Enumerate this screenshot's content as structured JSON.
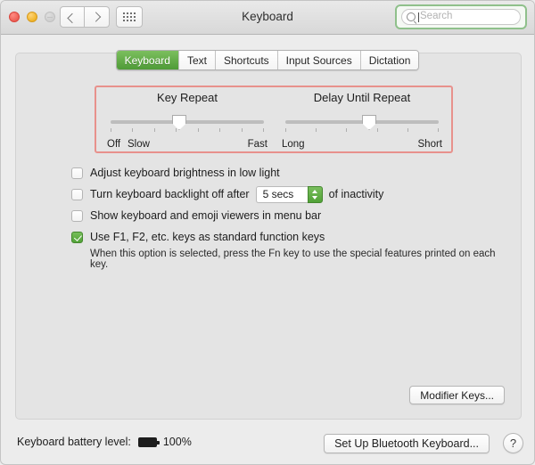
{
  "window": {
    "title": "Keyboard",
    "traffic_lights": [
      "close",
      "minimize",
      "zoom-disabled"
    ],
    "nav": {
      "back_icon": "chevron-left-icon",
      "forward_icon": "chevron-right-icon",
      "grid_icon": "show-all-grid-icon"
    }
  },
  "search": {
    "placeholder": "Search",
    "icon": "search-icon",
    "highlight_color": "#8fc08b"
  },
  "tabs": [
    {
      "label": "Keyboard",
      "selected": true
    },
    {
      "label": "Text",
      "selected": false
    },
    {
      "label": "Shortcuts",
      "selected": false
    },
    {
      "label": "Input Sources",
      "selected": false
    },
    {
      "label": "Dictation",
      "selected": false
    }
  ],
  "annotation": {
    "color": "#e8918c",
    "target": "key-repeat-and-delay-sliders"
  },
  "sliders": [
    {
      "title": "Key Repeat",
      "left_label": "Off",
      "second_label": "Slow",
      "right_label": "Fast",
      "value_percent": 45,
      "tick_count": 8
    },
    {
      "title": "Delay Until Repeat",
      "left_label": "Long",
      "second_label": "",
      "right_label": "Short",
      "value_percent": 55,
      "tick_count": 6
    }
  ],
  "options": [
    {
      "label": "Adjust keyboard brightness in low light",
      "checked": false
    },
    {
      "label": "Turn keyboard backlight off after",
      "checked": false,
      "stepper_value": "5 secs",
      "label_after": "of inactivity"
    },
    {
      "label": "Show keyboard and emoji viewers in menu bar",
      "checked": false
    },
    {
      "label": "Use F1, F2, etc. keys as standard function keys",
      "checked": true,
      "sub_label": "When this option is selected, press the Fn key to use the special features printed on each key."
    }
  ],
  "buttons": {
    "modifier_keys": "Modifier Keys...",
    "setup_bluetooth": "Set Up Bluetooth Keyboard...",
    "help": "?"
  },
  "footer": {
    "battery_label": "Keyboard battery level:",
    "battery_percent": "100%",
    "battery_icon": "battery-full-icon"
  }
}
